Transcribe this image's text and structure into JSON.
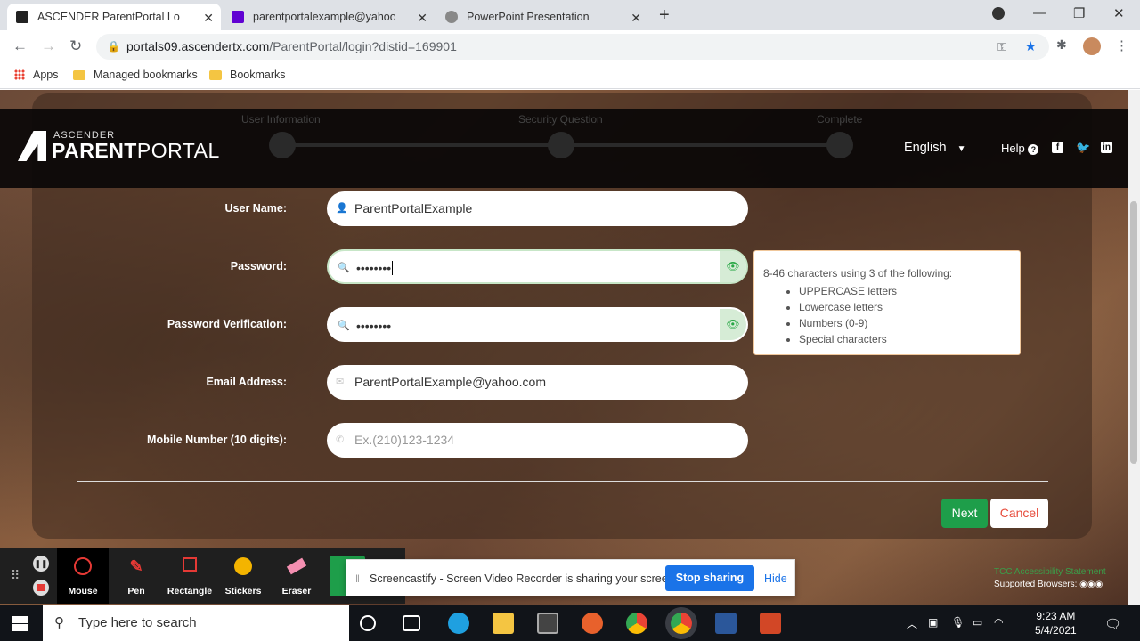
{
  "browser": {
    "tabs": [
      {
        "title": "ASCENDER ParentPortal Login",
        "active": true
      },
      {
        "title": "parentportalexample@yahoo.com",
        "active": false
      },
      {
        "title": "PowerPoint Presentation",
        "active": false
      }
    ],
    "url_host": "portals09.ascendertx.com",
    "url_path": "/ParentPortal/login?distid=169901",
    "bookmarks": [
      "Apps",
      "Managed bookmarks",
      "Bookmarks"
    ]
  },
  "header": {
    "logo_small": "ASCENDER",
    "logo_parent": "PARENT",
    "logo_portal": "PORTAL",
    "steps": [
      "User Information",
      "Security Question",
      "Complete"
    ],
    "language": "English",
    "help": "Help"
  },
  "form": {
    "username": {
      "label": "User Name:",
      "value": "ParentPortalExample"
    },
    "password": {
      "label": "Password:",
      "value": "••••••••"
    },
    "password_verify": {
      "label": "Password Verification:",
      "value": "••••••••"
    },
    "email": {
      "label": "Email Address:",
      "value": "ParentPortalExample@yahoo.com"
    },
    "mobile": {
      "label": "Mobile Number (10 digits):",
      "placeholder": "Ex.(210)123-1234"
    }
  },
  "tooltip": {
    "intro": "8-46 characters using 3 of the following:",
    "rules": [
      "UPPERCASE letters",
      "Lowercase letters",
      "Numbers (0-9)",
      "Special characters"
    ]
  },
  "buttons": {
    "next": "Next",
    "cancel": "Cancel"
  },
  "footer": {
    "accessibility": "TCC Accessibility Statement",
    "supported": "Supported Browsers:"
  },
  "screencastify": {
    "tools": [
      "Mouse",
      "Pen",
      "Rectangle",
      "Stickers",
      "Eraser"
    ],
    "message": "Screencastify - Screen Video Recorder is sharing your screen.",
    "stop": "Stop sharing",
    "hide": "Hide"
  },
  "taskbar": {
    "search_placeholder": "Type here to search",
    "time": "9:23 AM",
    "date": "5/4/2021"
  }
}
